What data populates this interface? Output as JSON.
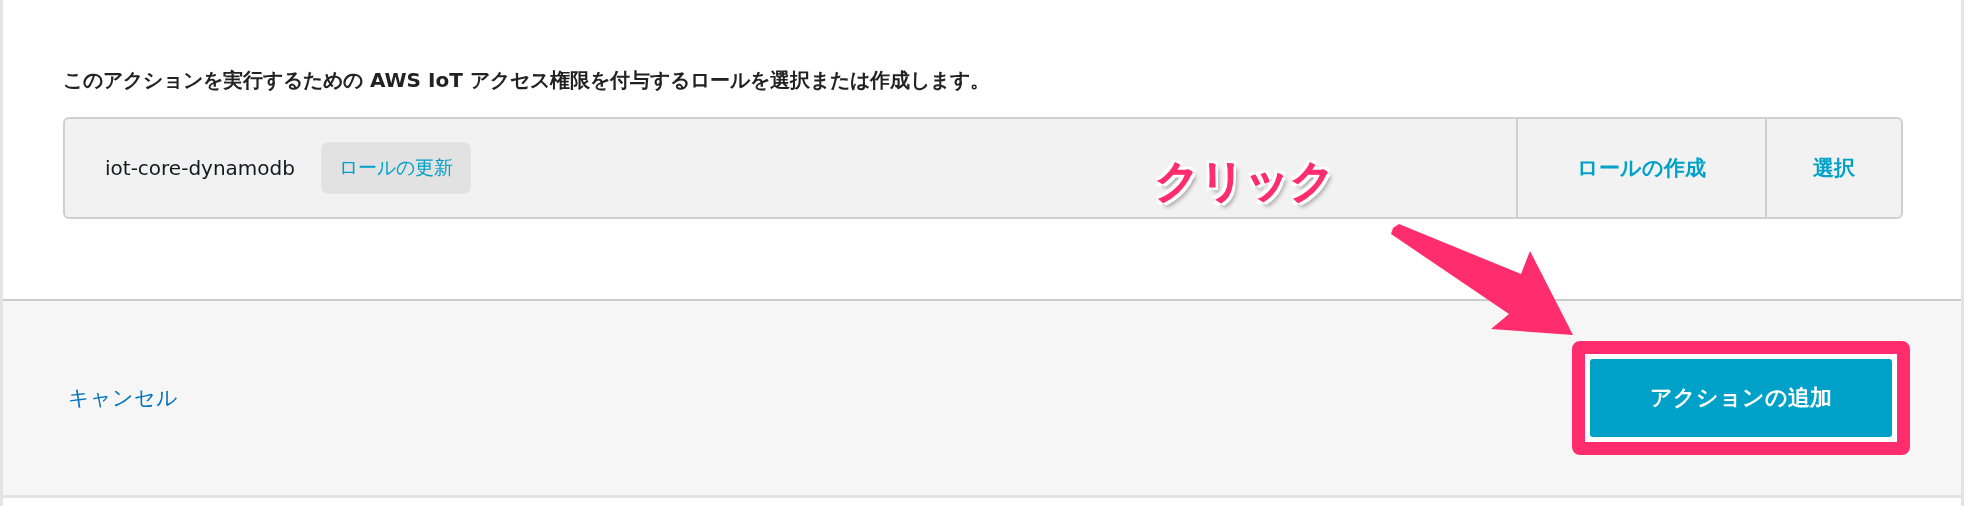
{
  "instruction": "このアクションを実行するための AWS IoT アクセス権限を付与するロールを選択または作成します。",
  "role": {
    "name": "iot-core-dynamodb",
    "update_button": "ロールの更新",
    "create_button": "ロールの作成",
    "select_button": "選択"
  },
  "footer": {
    "cancel": "キャンセル",
    "add_button": "アクションの追加"
  },
  "annotation": {
    "label": "クリック"
  }
}
